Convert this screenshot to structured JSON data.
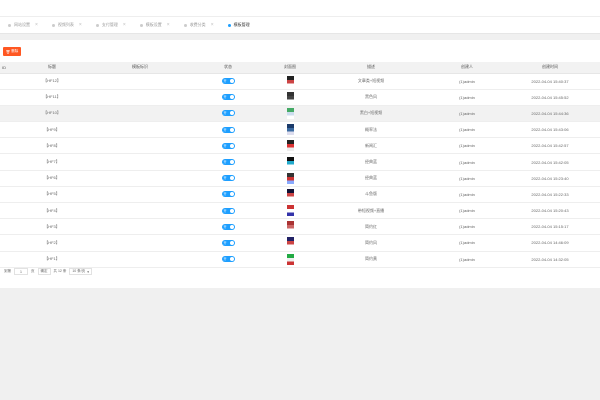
{
  "tabs": [
    {
      "label": "网站设置",
      "active": false
    },
    {
      "label": "视频列表",
      "active": false
    },
    {
      "label": "支付管理",
      "active": false
    },
    {
      "label": "模板设置",
      "active": false
    },
    {
      "label": "收费分类",
      "active": false
    },
    {
      "label": "模板管理",
      "active": true
    }
  ],
  "toolbar": {
    "delete_label": "删除"
  },
  "table": {
    "headers": [
      "ID",
      "标题",
      "模板标识",
      "状态",
      "封面图",
      "描述",
      "创建人",
      "创建时间"
    ],
    "switch_label": "开",
    "rows": [
      {
        "id": "",
        "title": "【HF12】",
        "status": "开",
        "desc": "文章类+短视频",
        "creator": "(1)admin",
        "time": "2022-04-04 15:40:37"
      },
      {
        "id": "",
        "title": "【HF11】",
        "status": "开",
        "desc": "黑色风",
        "creator": "(1)admin",
        "time": "2022-04-04 15:45:52"
      },
      {
        "id": "",
        "title": "【HF10】",
        "status": "开",
        "desc": "黑白+短视频",
        "creator": "(1)admin",
        "time": "2022-04-04 15:44:36"
      },
      {
        "id": "",
        "title": "【HF9】",
        "status": "开",
        "desc": "概率法",
        "creator": "(1)admin",
        "time": "2022-04-04 15:43:06"
      },
      {
        "id": "",
        "title": "【HF8】",
        "status": "开",
        "desc": "新闻汇",
        "creator": "(1)admin",
        "time": "2022-04-04 15:42:57"
      },
      {
        "id": "",
        "title": "【HF7】",
        "status": "开",
        "desc": "经典蓝",
        "creator": "(1)admin",
        "time": "2022-04-04 15:42:05"
      },
      {
        "id": "",
        "title": "【HF6】",
        "status": "开",
        "desc": "经典蓝",
        "creator": "(1)admin",
        "time": "2022-04-04 15:23:40"
      },
      {
        "id": "",
        "title": "【HF5】",
        "status": "开",
        "desc": "斗鱼版",
        "creator": "(1)admin",
        "time": "2022-04-04 15:22:33"
      },
      {
        "id": "",
        "title": "【HF4】",
        "status": "开",
        "desc": "带短视频+直播",
        "creator": "(1)admin",
        "time": "2022-04-04 15:20:43"
      },
      {
        "id": "",
        "title": "【HF3】",
        "status": "开",
        "desc": "简约红",
        "creator": "(1)admin",
        "time": "2022-04-04 15:15:17"
      },
      {
        "id": "",
        "title": "【HF2】",
        "status": "开",
        "desc": "简约风",
        "creator": "(1)admin",
        "time": "2022-04-04 14:46:09"
      },
      {
        "id": "",
        "title": "【HF1】",
        "status": "开",
        "desc": "简约黄",
        "creator": "(1)admin",
        "time": "2022-04-04 14:32:05"
      }
    ]
  },
  "pager": {
    "goto_label": "到第",
    "page_value": "1",
    "page_unit": "页",
    "confirm_label": "确定",
    "total_label": "共 12 条",
    "size_label": "10 条/页"
  },
  "colors": {
    "accent": "#1e9fff",
    "danger": "#ff5722"
  }
}
